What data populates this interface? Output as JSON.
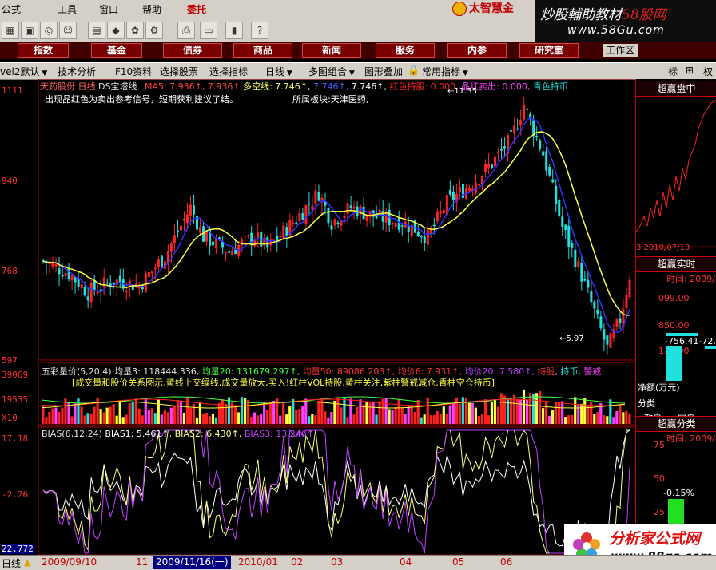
{
  "menu": {
    "items": [
      "公式",
      "工具",
      "窗口",
      "帮助",
      "委托"
    ],
    "brand": "太智慧金"
  },
  "watermark_top": {
    "title_a": "炒股輔助教材",
    "title_b": "58股网",
    "url": "www.58Gu.com"
  },
  "func_tabs": [
    "指数",
    "基金",
    "债券",
    "商品",
    "新闻",
    "服务",
    "内参",
    "研究室"
  ],
  "workarea": "工作区",
  "analysis_bar": {
    "items": [
      "vel2默认",
      "技术分析",
      "F10资料",
      "选择股票",
      "选择指标",
      "日线",
      "多图组合",
      "图形叠加",
      "常用指标"
    ],
    "right_btns": [
      "标",
      "⊞",
      "权"
    ]
  },
  "price_panel": {
    "stock": "天药股份",
    "period": "日线",
    "indicator": "DS宝塔线",
    "ma5": "MA5: 7.936",
    "ma5b": "7.936",
    "multi": "多空线: 7.746",
    "v3": "7.746",
    "v4": "7.746",
    "red_hold": "红色持股: 0.000",
    "jing_sell": "晶红卖出: 0.000",
    "cyan_hold": "青色持币",
    "note": "出现晶红色为卖出参考信号，短期获利建议了结。",
    "sector": "所属板块:天津医药,",
    "y_ticks": [
      "1111",
      "940",
      "768",
      "597"
    ],
    "high_label": "11.35",
    "low_label": "5.97"
  },
  "volume_panel": {
    "title": "五彩量价(5,20,4)",
    "avg3": "均量3: 118444.336",
    "avg20": "均量20: 131679.297",
    "avg50": "均量50: 89086.203",
    "avgp6": "均价6: 7.931",
    "avgp20": "均价20: 7.580",
    "hold": "持股",
    "coin": "持币",
    "warn": "警戒",
    "note": "[成交量和股价关系图示,黄线上交绿线,成交量放大,买入!红柱VOL持股,黄柱关注,紫柱警戒减仓,青柱空仓持币]",
    "y_ticks": [
      "39069",
      "19535",
      "X10"
    ]
  },
  "bias_panel": {
    "title": "BIAS(6,12,24)",
    "b1": "BIAS1: 5.461",
    "b2": "BIAS2: 6.430",
    "b3": "BIAS3: 13.246",
    "y_ticks": [
      "17.18",
      "-2.26",
      "22.772"
    ]
  },
  "right_panel": {
    "h1": "超赢盘中",
    "code": "3 2010/07/13",
    "h2": "超赢实时",
    "time1": "时间: 2009/",
    "v1": "099.00",
    "v2": "850.00",
    "v3": "137.00",
    "val": "-756.41-72.",
    "netlabel": "净额(万元)",
    "cls": "分类",
    "retail": "散户",
    "mid": "中户",
    "h3": "超赢分类",
    "time2": "时间: 2009/",
    "t75": "75",
    "t50": "50",
    "t25": "25",
    "pct": "-0.15%"
  },
  "bottom_bar": {
    "period": "日线",
    "dates": [
      "2009/09/10",
      "11",
      "2010/01",
      "02",
      "03",
      "04",
      "05",
      "06"
    ],
    "current": "2009/11/16(一)"
  },
  "watermark_bottom": {
    "name": "分析家公式网",
    "url": "www.88gs.com"
  },
  "colors": {
    "up": "#ff2020",
    "down": "#20e0e0",
    "ma_fast": "#3030ff",
    "ma_slow": "#ffff40",
    "bias1": "#ffffff",
    "bias2": "#ffff80",
    "bias3": "#c040ff"
  }
}
